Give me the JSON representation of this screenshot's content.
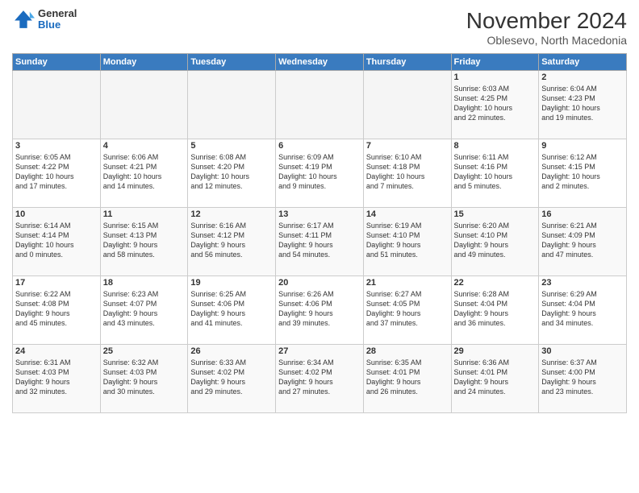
{
  "logo": {
    "general": "General",
    "blue": "Blue"
  },
  "title": "November 2024",
  "location": "Oblesevo, North Macedonia",
  "days_header": [
    "Sunday",
    "Monday",
    "Tuesday",
    "Wednesday",
    "Thursday",
    "Friday",
    "Saturday"
  ],
  "weeks": [
    [
      {
        "day": "",
        "info": "",
        "empty": true
      },
      {
        "day": "",
        "info": "",
        "empty": true
      },
      {
        "day": "",
        "info": "",
        "empty": true
      },
      {
        "day": "",
        "info": "",
        "empty": true
      },
      {
        "day": "",
        "info": "",
        "empty": true
      },
      {
        "day": "1",
        "info": "Sunrise: 6:03 AM\nSunset: 4:25 PM\nDaylight: 10 hours\nand 22 minutes.",
        "empty": false
      },
      {
        "day": "2",
        "info": "Sunrise: 6:04 AM\nSunset: 4:23 PM\nDaylight: 10 hours\nand 19 minutes.",
        "empty": false
      }
    ],
    [
      {
        "day": "3",
        "info": "Sunrise: 6:05 AM\nSunset: 4:22 PM\nDaylight: 10 hours\nand 17 minutes.",
        "empty": false
      },
      {
        "day": "4",
        "info": "Sunrise: 6:06 AM\nSunset: 4:21 PM\nDaylight: 10 hours\nand 14 minutes.",
        "empty": false
      },
      {
        "day": "5",
        "info": "Sunrise: 6:08 AM\nSunset: 4:20 PM\nDaylight: 10 hours\nand 12 minutes.",
        "empty": false
      },
      {
        "day": "6",
        "info": "Sunrise: 6:09 AM\nSunset: 4:19 PM\nDaylight: 10 hours\nand 9 minutes.",
        "empty": false
      },
      {
        "day": "7",
        "info": "Sunrise: 6:10 AM\nSunset: 4:18 PM\nDaylight: 10 hours\nand 7 minutes.",
        "empty": false
      },
      {
        "day": "8",
        "info": "Sunrise: 6:11 AM\nSunset: 4:16 PM\nDaylight: 10 hours\nand 5 minutes.",
        "empty": false
      },
      {
        "day": "9",
        "info": "Sunrise: 6:12 AM\nSunset: 4:15 PM\nDaylight: 10 hours\nand 2 minutes.",
        "empty": false
      }
    ],
    [
      {
        "day": "10",
        "info": "Sunrise: 6:14 AM\nSunset: 4:14 PM\nDaylight: 10 hours\nand 0 minutes.",
        "empty": false
      },
      {
        "day": "11",
        "info": "Sunrise: 6:15 AM\nSunset: 4:13 PM\nDaylight: 9 hours\nand 58 minutes.",
        "empty": false
      },
      {
        "day": "12",
        "info": "Sunrise: 6:16 AM\nSunset: 4:12 PM\nDaylight: 9 hours\nand 56 minutes.",
        "empty": false
      },
      {
        "day": "13",
        "info": "Sunrise: 6:17 AM\nSunset: 4:11 PM\nDaylight: 9 hours\nand 54 minutes.",
        "empty": false
      },
      {
        "day": "14",
        "info": "Sunrise: 6:19 AM\nSunset: 4:10 PM\nDaylight: 9 hours\nand 51 minutes.",
        "empty": false
      },
      {
        "day": "15",
        "info": "Sunrise: 6:20 AM\nSunset: 4:10 PM\nDaylight: 9 hours\nand 49 minutes.",
        "empty": false
      },
      {
        "day": "16",
        "info": "Sunrise: 6:21 AM\nSunset: 4:09 PM\nDaylight: 9 hours\nand 47 minutes.",
        "empty": false
      }
    ],
    [
      {
        "day": "17",
        "info": "Sunrise: 6:22 AM\nSunset: 4:08 PM\nDaylight: 9 hours\nand 45 minutes.",
        "empty": false
      },
      {
        "day": "18",
        "info": "Sunrise: 6:23 AM\nSunset: 4:07 PM\nDaylight: 9 hours\nand 43 minutes.",
        "empty": false
      },
      {
        "day": "19",
        "info": "Sunrise: 6:25 AM\nSunset: 4:06 PM\nDaylight: 9 hours\nand 41 minutes.",
        "empty": false
      },
      {
        "day": "20",
        "info": "Sunrise: 6:26 AM\nSunset: 4:06 PM\nDaylight: 9 hours\nand 39 minutes.",
        "empty": false
      },
      {
        "day": "21",
        "info": "Sunrise: 6:27 AM\nSunset: 4:05 PM\nDaylight: 9 hours\nand 37 minutes.",
        "empty": false
      },
      {
        "day": "22",
        "info": "Sunrise: 6:28 AM\nSunset: 4:04 PM\nDaylight: 9 hours\nand 36 minutes.",
        "empty": false
      },
      {
        "day": "23",
        "info": "Sunrise: 6:29 AM\nSunset: 4:04 PM\nDaylight: 9 hours\nand 34 minutes.",
        "empty": false
      }
    ],
    [
      {
        "day": "24",
        "info": "Sunrise: 6:31 AM\nSunset: 4:03 PM\nDaylight: 9 hours\nand 32 minutes.",
        "empty": false
      },
      {
        "day": "25",
        "info": "Sunrise: 6:32 AM\nSunset: 4:03 PM\nDaylight: 9 hours\nand 30 minutes.",
        "empty": false
      },
      {
        "day": "26",
        "info": "Sunrise: 6:33 AM\nSunset: 4:02 PM\nDaylight: 9 hours\nand 29 minutes.",
        "empty": false
      },
      {
        "day": "27",
        "info": "Sunrise: 6:34 AM\nSunset: 4:02 PM\nDaylight: 9 hours\nand 27 minutes.",
        "empty": false
      },
      {
        "day": "28",
        "info": "Sunrise: 6:35 AM\nSunset: 4:01 PM\nDaylight: 9 hours\nand 26 minutes.",
        "empty": false
      },
      {
        "day": "29",
        "info": "Sunrise: 6:36 AM\nSunset: 4:01 PM\nDaylight: 9 hours\nand 24 minutes.",
        "empty": false
      },
      {
        "day": "30",
        "info": "Sunrise: 6:37 AM\nSunset: 4:00 PM\nDaylight: 9 hours\nand 23 minutes.",
        "empty": false
      }
    ]
  ]
}
